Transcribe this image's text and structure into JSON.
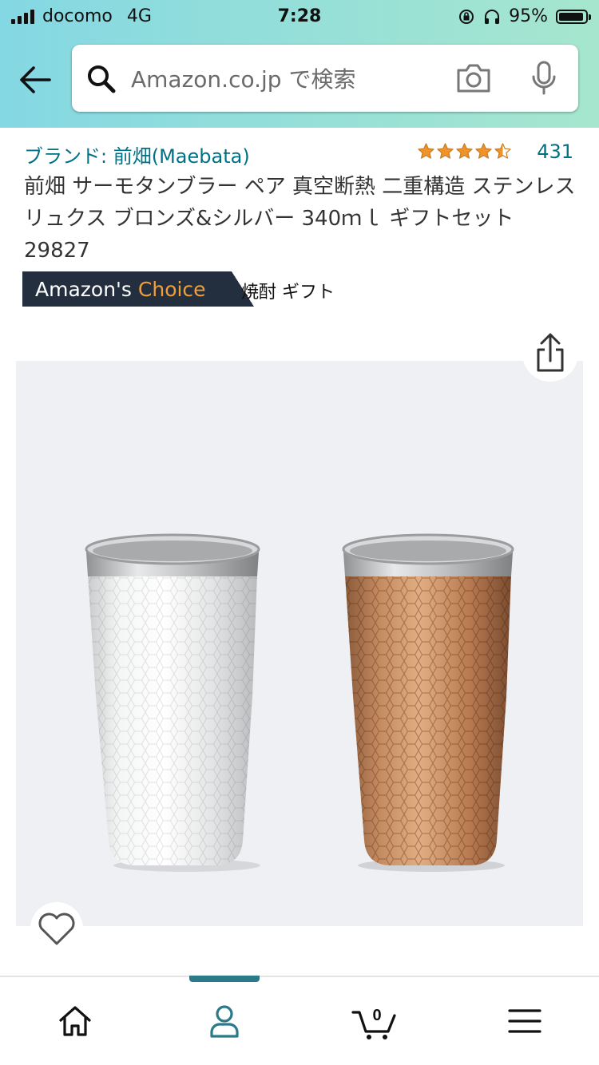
{
  "status_bar": {
    "carrier": "docomo",
    "network": "4G",
    "time": "7:28",
    "battery": "95%",
    "battery_level": 0.95
  },
  "search": {
    "placeholder": "Amazon.co.jp で検索"
  },
  "product": {
    "brand": "ブランド: 前畑(Maebata)",
    "rating": 4.5,
    "review_count": "431",
    "title": "前畑 サーモタンブラー ペア 真空断熱 二重構造 ステンレス リュクス ブロンズ&シルバー 340ｍｌ ギフトセット 29827"
  },
  "badge": {
    "prefix": "Amazon's",
    "suffix": "Choice",
    "keyword": "焼酎 ギフト"
  },
  "cart": {
    "count": "0"
  },
  "colors": {
    "link": "#007185",
    "badge_bg": "#232f3e",
    "badge_accent": "#f19e39",
    "star": "#f0932b",
    "tab_active": "#2b7a8a"
  },
  "icons": [
    "back-arrow-icon",
    "search-icon",
    "camera-icon",
    "microphone-icon",
    "share-icon",
    "heart-icon",
    "home-icon",
    "account-icon",
    "cart-icon",
    "menu-icon"
  ]
}
